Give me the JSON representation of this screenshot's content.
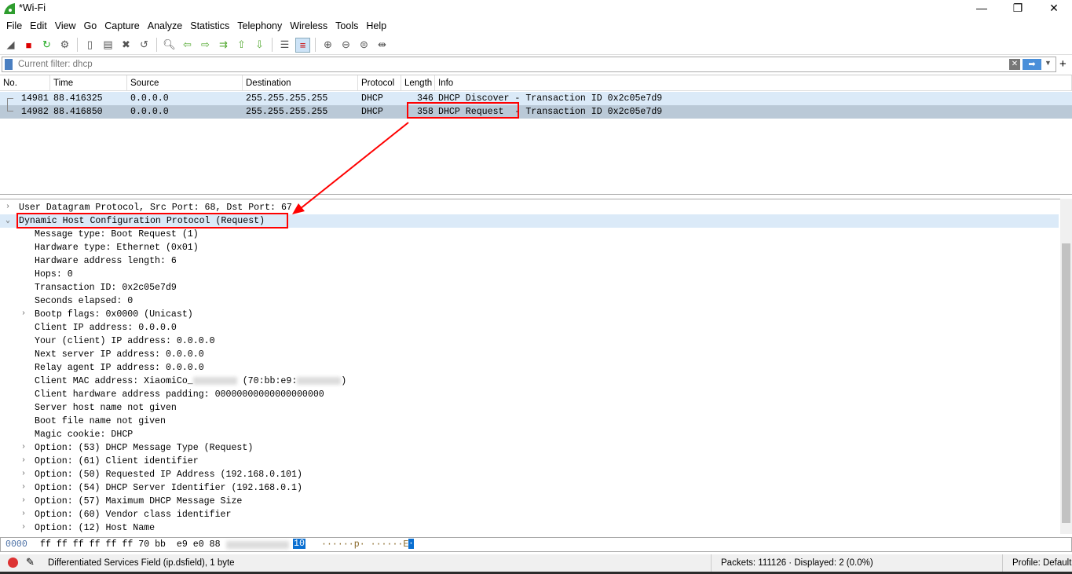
{
  "window": {
    "title": "*Wi-Fi",
    "minimize": "—",
    "restore": "❐",
    "close": "✕"
  },
  "menu": [
    "File",
    "Edit",
    "View",
    "Go",
    "Capture",
    "Analyze",
    "Statistics",
    "Telephony",
    "Wireless",
    "Tools",
    "Help"
  ],
  "toolbar_icons": [
    "shark-fin-start-icon",
    "stop-icon",
    "restart-icon",
    "options-gear-icon",
    "open-file-icon",
    "save-file-icon",
    "close-file-icon",
    "reload-icon",
    "find-icon",
    "back-icon",
    "forward-icon",
    "goto-icon",
    "first-icon",
    "last-icon",
    "autoscroll-icon",
    "colorize-icon",
    "zoom-in-icon",
    "zoom-out-icon",
    "normal-size-icon",
    "resize-columns-icon"
  ],
  "filter": {
    "placeholder": "Current filter: dhcp",
    "value": ""
  },
  "columns": [
    "No.",
    "Time",
    "Source",
    "Destination",
    "Protocol",
    "Length",
    "Info"
  ],
  "packets": [
    {
      "no": "14981",
      "time": "88.416325",
      "src": "0.0.0.0",
      "dst": "255.255.255.255",
      "proto": "DHCP",
      "len": "346",
      "info": "DHCP Discover - Transaction ID 0x2c05e7d9"
    },
    {
      "no": "14982",
      "time": "88.416850",
      "src": "0.0.0.0",
      "dst": "255.255.255.255",
      "proto": "DHCP",
      "len": "358",
      "info": "DHCP Request  - Transaction ID 0x2c05e7d9"
    }
  ],
  "details": [
    {
      "text": "User Datagram Protocol, Src Port: 68, Dst Port: 67",
      "indent": 0,
      "exp": ">"
    },
    {
      "text": "Dynamic Host Configuration Protocol (Request)",
      "indent": 0,
      "exp": "v",
      "sel": true
    },
    {
      "text": "Message type: Boot Request (1)",
      "indent": 1
    },
    {
      "text": "Hardware type: Ethernet (0x01)",
      "indent": 1
    },
    {
      "text": "Hardware address length: 6",
      "indent": 1
    },
    {
      "text": "Hops: 0",
      "indent": 1
    },
    {
      "text": "Transaction ID: 0x2c05e7d9",
      "indent": 1
    },
    {
      "text": "Seconds elapsed: 0",
      "indent": 1
    },
    {
      "text": "Bootp flags: 0x0000 (Unicast)",
      "indent": 1,
      "exp": ">"
    },
    {
      "text": "Client IP address: 0.0.0.0",
      "indent": 1
    },
    {
      "text": "Your (client) IP address: 0.0.0.0",
      "indent": 1
    },
    {
      "text": "Next server IP address: 0.0.0.0",
      "indent": 1
    },
    {
      "text": "Relay agent IP address: 0.0.0.0",
      "indent": 1
    },
    {
      "text": "Client MAC address: XiaomiCo_",
      "indent": 1,
      "mac": true
    },
    {
      "text": "Client hardware address padding: 00000000000000000000",
      "indent": 1
    },
    {
      "text": "Server host name not given",
      "indent": 1
    },
    {
      "text": "Boot file name not given",
      "indent": 1
    },
    {
      "text": "Magic cookie: DHCP",
      "indent": 1
    },
    {
      "text": "Option: (53) DHCP Message Type (Request)",
      "indent": 1,
      "exp": ">"
    },
    {
      "text": "Option: (61) Client identifier",
      "indent": 1,
      "exp": ">"
    },
    {
      "text": "Option: (50) Requested IP Address (192.168.0.101)",
      "indent": 1,
      "exp": ">"
    },
    {
      "text": "Option: (54) DHCP Server Identifier (192.168.0.1)",
      "indent": 1,
      "exp": ">"
    },
    {
      "text": "Option: (57) Maximum DHCP Message Size",
      "indent": 1,
      "exp": ">"
    },
    {
      "text": "Option: (60) Vendor class identifier",
      "indent": 1,
      "exp": ">"
    },
    {
      "text": "Option: (12) Host Name",
      "indent": 1,
      "exp": ">"
    }
  ],
  "mac_mid": " (70:bb:e9:",
  "mac_end": ")",
  "hex": {
    "offset": "0000",
    "bytes": "ff ff ff ff ff ff 70 bb  e9 e0 88",
    "sel_byte": "10",
    "ascii": "······p· ······E",
    "ascii_sel": "·"
  },
  "status": {
    "field": "Differentiated Services Field (ip.dsfield), 1 byte",
    "packets": "Packets: 111126 · Displayed: 2 (0.0%)",
    "profile": "Profile: Default"
  },
  "colors": {
    "selected_row": "#bac9d7",
    "row_light": "#dbeaf8",
    "highlight_box": "#ff0000",
    "selected_tree": "#dbeaf8"
  }
}
